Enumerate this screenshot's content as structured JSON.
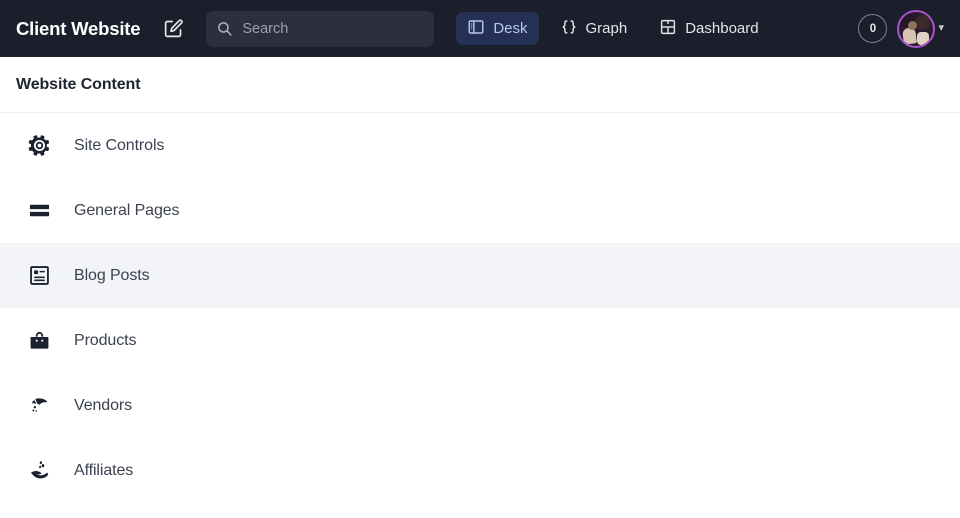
{
  "navbar": {
    "brand_title": "Client Website",
    "new_doc_icon": "edit-square-icon",
    "search": {
      "icon": "search-icon",
      "placeholder": "Search",
      "value": ""
    },
    "links": [
      {
        "label": "Desk",
        "icon": "desk-panels-icon",
        "active": true
      },
      {
        "label": "Graph",
        "icon": "curly-braces-icon",
        "active": false
      },
      {
        "label": "Dashboard",
        "icon": "dashboard-grid-icon",
        "active": false
      }
    ],
    "notification_count": "0",
    "avatar_caret_icon": "chevron-down-icon"
  },
  "section": {
    "title": "Website Content"
  },
  "list": {
    "items": [
      {
        "label": "Site Controls",
        "icon": "gear-icon",
        "selected": false
      },
      {
        "label": "General Pages",
        "icon": "pages-bars-icon",
        "selected": false
      },
      {
        "label": "Blog Posts",
        "icon": "article-icon",
        "selected": true
      },
      {
        "label": "Products",
        "icon": "shopping-bag-icon",
        "selected": false
      },
      {
        "label": "Vendors",
        "icon": "hand-pointing-icon",
        "selected": false
      },
      {
        "label": "Affiliates",
        "icon": "hand-coins-icon",
        "selected": false
      }
    ]
  },
  "colors": {
    "navbar_bg": "#1b1f2b",
    "search_bg": "#2b303c",
    "active_pill_bg": "#253055",
    "active_pill_text": "#b9c8f2",
    "selected_row_bg": "#f3f4f8",
    "avatar_ring": "#a855c9"
  }
}
